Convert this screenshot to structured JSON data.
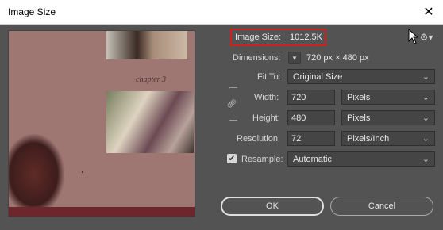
{
  "window": {
    "title": "Image Size",
    "close_glyph": "✕"
  },
  "preview": {
    "caption": "chapter 3"
  },
  "image_size": {
    "label": "Image Size:",
    "value": "1012.5K"
  },
  "settings_icon": "gear-icon",
  "dimensions": {
    "label": "Dimensions:",
    "value": "720 px  ×  480 px"
  },
  "fit_to": {
    "label": "Fit To:",
    "selected": "Original Size"
  },
  "width": {
    "label": "Width:",
    "value": "720",
    "unit": "Pixels"
  },
  "height": {
    "label": "Height:",
    "value": "480",
    "unit": "Pixels"
  },
  "resolution": {
    "label": "Resolution:",
    "value": "72",
    "unit": "Pixels/Inch"
  },
  "resample": {
    "label": "Resample:",
    "checked": true,
    "selected": "Automatic"
  },
  "buttons": {
    "ok": "OK",
    "cancel": "Cancel"
  },
  "colors": {
    "highlight": "#d21f1f",
    "background": "#535353"
  }
}
